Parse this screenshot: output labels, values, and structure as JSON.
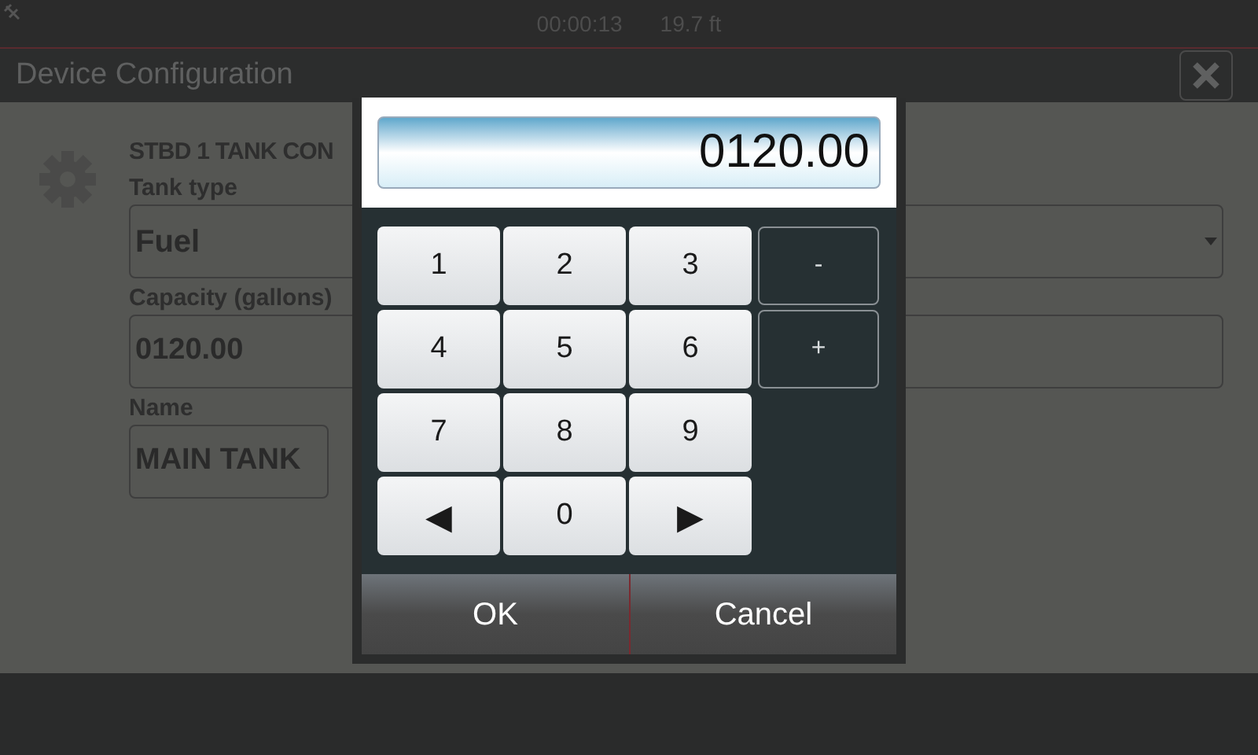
{
  "status_bar": {
    "time": "00:00:13",
    "depth": "19.7 ft"
  },
  "window": {
    "title": "Device Configuration"
  },
  "form": {
    "heading": "STBD 1 TANK CON",
    "fields": [
      {
        "kind": "dropdown",
        "label": "Tank type",
        "value": "Fuel"
      },
      {
        "kind": "text",
        "label": "Capacity (gallons)",
        "value": "0120.00"
      },
      {
        "kind": "short",
        "label": "Name",
        "value": "MAIN TANK"
      }
    ]
  },
  "keypad_dialog": {
    "value": "0120.00",
    "rows": [
      [
        {
          "kind": "digit",
          "label": "1"
        },
        {
          "kind": "digit",
          "label": "2"
        },
        {
          "kind": "digit",
          "label": "3"
        },
        {
          "kind": "sign",
          "label": "-"
        }
      ],
      [
        {
          "kind": "digit",
          "label": "4"
        },
        {
          "kind": "digit",
          "label": "5"
        },
        {
          "kind": "digit",
          "label": "6"
        },
        {
          "kind": "sign",
          "label": "+"
        }
      ],
      [
        {
          "kind": "digit",
          "label": "7"
        },
        {
          "kind": "digit",
          "label": "8"
        },
        {
          "kind": "digit",
          "label": "9"
        }
      ],
      [
        {
          "kind": "arrow",
          "label": "◀"
        },
        {
          "kind": "digit",
          "label": "0"
        },
        {
          "kind": "arrow",
          "label": "▶"
        }
      ]
    ],
    "buttons": [
      "OK",
      "Cancel"
    ]
  }
}
